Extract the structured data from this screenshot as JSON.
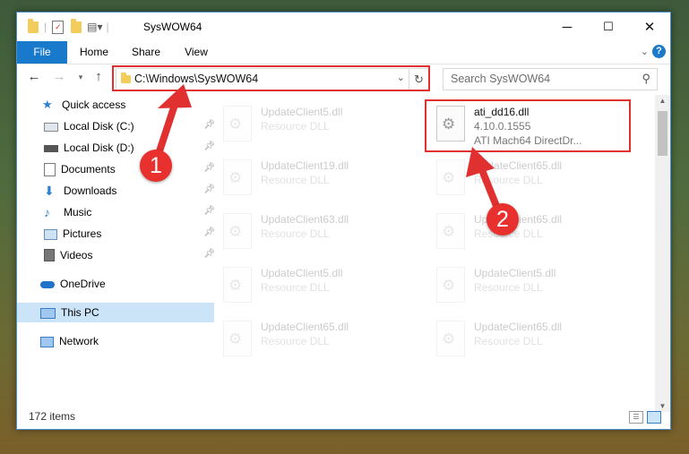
{
  "window": {
    "title": "SysWOW64",
    "controls": {
      "minimize": "─",
      "maximize": "☐",
      "close": "✕"
    }
  },
  "ribbon": {
    "tabs": [
      "File",
      "Home",
      "Share",
      "View"
    ],
    "accent": "#1979ca"
  },
  "address": {
    "path": "C:\\Windows\\SysWOW64"
  },
  "search": {
    "placeholder": "Search SysWOW64"
  },
  "sidebar": {
    "items": [
      {
        "label": "Quick access",
        "icon": "star-icon"
      },
      {
        "label": "Local Disk (C:)",
        "icon": "drive-icon",
        "pinned": true
      },
      {
        "label": "Local Disk (D:)",
        "icon": "drive-icon",
        "pinned": true
      },
      {
        "label": "Documents",
        "icon": "documents-icon",
        "pinned": true
      },
      {
        "label": "Downloads",
        "icon": "downloads-icon",
        "pinned": true
      },
      {
        "label": "Music",
        "icon": "music-icon",
        "pinned": true
      },
      {
        "label": "Pictures",
        "icon": "pictures-icon",
        "pinned": true
      },
      {
        "label": "Videos",
        "icon": "videos-icon",
        "pinned": true
      },
      {
        "label": "OneDrive",
        "icon": "onedrive-icon"
      },
      {
        "label": "This PC",
        "icon": "this-pc-icon",
        "selected": true
      },
      {
        "label": "Network",
        "icon": "network-icon"
      }
    ]
  },
  "files": {
    "left": [
      {
        "name": "UpdateClient5.dll",
        "type": "Resource DLL"
      },
      {
        "name": "UpdateClient19.dll",
        "type": "Resource DLL"
      },
      {
        "name": "UpdateClient63.dll",
        "type": "Resource DLL"
      },
      {
        "name": "UpdateClient5.dll",
        "type": "Resource DLL"
      },
      {
        "name": "UpdateClient65.dll",
        "type": "Resource DLL"
      }
    ],
    "highlighted": {
      "name": "ati_dd16.dll",
      "version": "4.10.0.1555",
      "description": "ATI Mach64 DirectDr..."
    },
    "right": [
      {
        "name": "UpdateClient65.dll",
        "type": "Resource DLL"
      },
      {
        "name": "UpdateClient65.dll",
        "type": "Resource DLL"
      },
      {
        "name": "UpdateClient5.dll",
        "type": "Resource DLL"
      },
      {
        "name": "UpdateClient65.dll",
        "type": "Resource DLL"
      }
    ]
  },
  "status": {
    "items_count": "172 items"
  },
  "annotations": {
    "step1": "1",
    "step2": "2",
    "color": "#e03030"
  }
}
